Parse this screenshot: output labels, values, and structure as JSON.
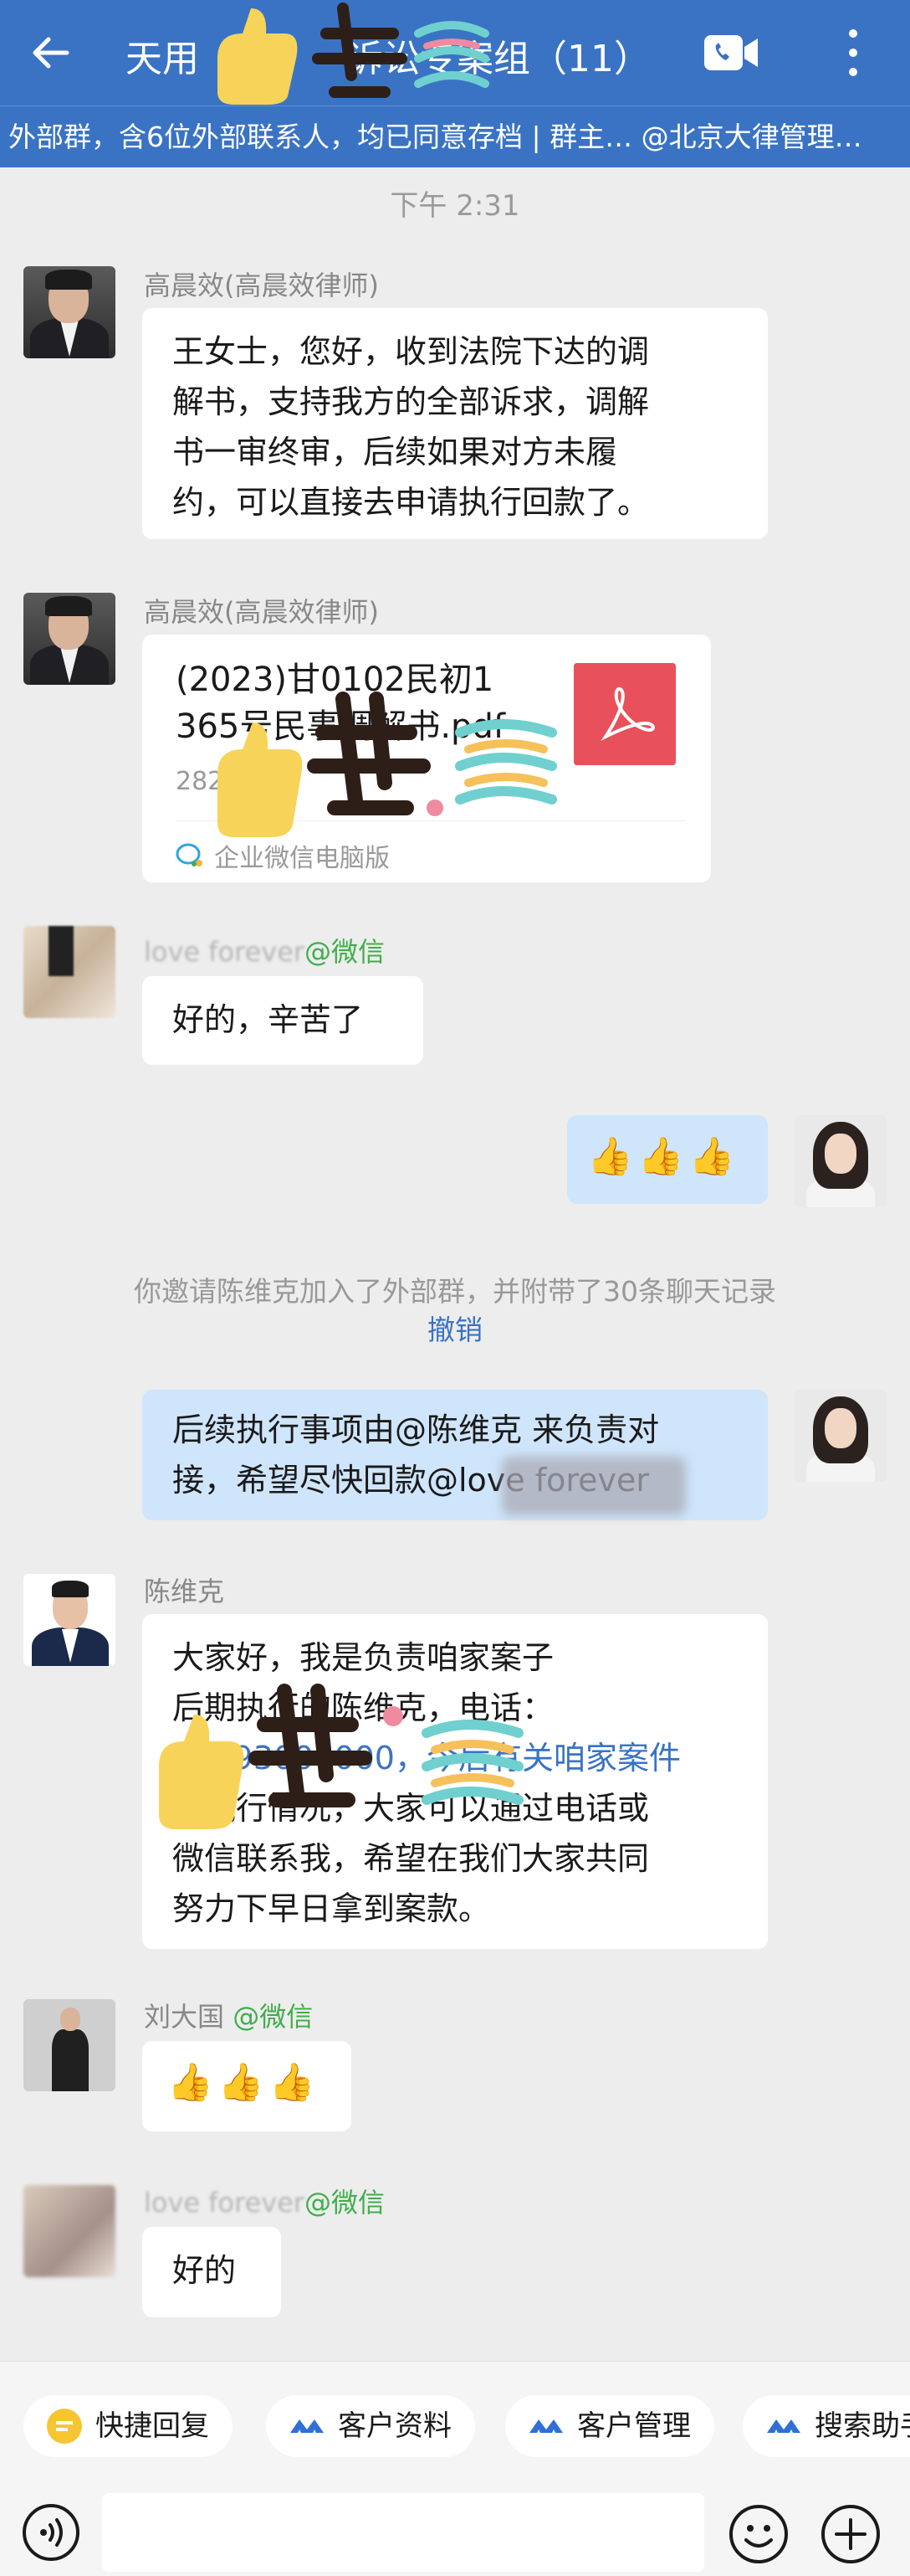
{
  "header": {
    "title": "天用　　　　诉讼专案组（11）",
    "subtitle": "外部群，含6位外部联系人，均已同意存档 | 群主… @北京大律管理…"
  },
  "time_label": "下午 2:31",
  "messages": [
    {
      "sender": "高晨效(高晨效律师)",
      "text_lines": [
        "王女士，您好，收到法院下达的调",
        "解书，支持我方的全部诉求，调解",
        "书一审终审，后续如果对方未履",
        "约，可以直接去申请执行回款了。"
      ]
    },
    {
      "sender": "高晨效(高晨效律师)",
      "file": {
        "name_lines": [
          "(2023)甘0102民初1",
          "365号民事调解书.pdf"
        ],
        "size": "282K",
        "source": "企业微信电脑版"
      }
    },
    {
      "sender_name": "love forever",
      "sender_suffix": "@微信",
      "text": "好的，辛苦了"
    },
    {
      "me": true,
      "text": "👍👍👍"
    },
    {
      "system": "你邀请陈维克加入了外部群，并附带了30条聊天记录",
      "system_link": "撤销"
    },
    {
      "me": true,
      "text_lines": [
        "后续执行事项由@陈维克  来负责对",
        "接，希望尽快回款@love forever"
      ]
    },
    {
      "sender": "陈维克",
      "text_lines": [
        "大家好，我是负责咱家案子",
        "后期执行的陈维克，电话：",
        "13993000000，今后有关咱家案件",
        "的执行情况，大家可以通过电话或",
        "微信联系我，希望在我们大家共同",
        "努力下早日拿到案款。"
      ]
    },
    {
      "sender_name": "刘大国",
      "sender_suffix": "@微信",
      "text": "👍👍👍"
    },
    {
      "sender_name": "love forever",
      "sender_suffix": "@微信",
      "text": "好的"
    }
  ],
  "quick_actions": [
    {
      "label": "快捷回复",
      "icon": "quick-reply-icon"
    },
    {
      "label": "客户资料",
      "icon": "customer-profile-icon"
    },
    {
      "label": "客户管理",
      "icon": "customer-manage-icon"
    },
    {
      "label": "搜索助手",
      "icon": "search-assistant-icon"
    }
  ],
  "colors": {
    "header": "#3a73c4",
    "my_bubble": "#cfe5fb",
    "wechat_green": "#3fae4b",
    "link": "#3a73c4"
  }
}
